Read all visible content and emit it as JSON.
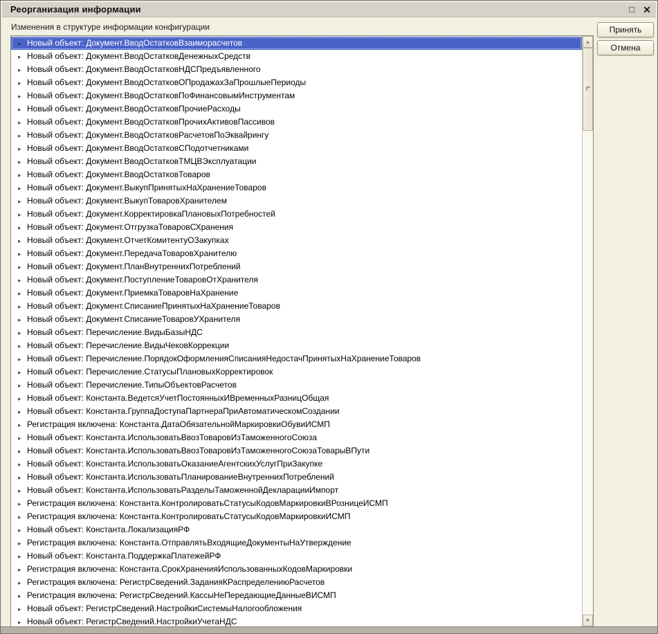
{
  "window": {
    "title": "Реорганизация информации"
  },
  "icons": {
    "maximize_glyph": "□",
    "close_glyph": "✕",
    "row_arrow_glyph": "▸",
    "scroll_up_glyph": "▲",
    "scroll_down_glyph": "▼"
  },
  "colors": {
    "dialog_background": "#f2f0e1",
    "titlebar_background": "#d6d2c9",
    "selection_background": "#4a63c8",
    "selection_text": "#ffffff",
    "list_background": "#ffffff"
  },
  "header": {
    "label": "Изменения в структуре информации конфигурации"
  },
  "buttons": {
    "accept": "Принять",
    "cancel": "Отмена"
  },
  "list": {
    "selected_index": 0,
    "items": [
      {
        "label": "Новый объект: Документ.ВводОстатковВзаиморасчетов"
      },
      {
        "label": "Новый объект: Документ.ВводОстатковДенежныхСредств"
      },
      {
        "label": "Новый объект: Документ.ВводОстатковНДСПредъявленного"
      },
      {
        "label": "Новый объект: Документ.ВводОстатковОПродажахЗаПрошлыеПериоды"
      },
      {
        "label": "Новый объект: Документ.ВводОстатковПоФинансовымИнструментам"
      },
      {
        "label": "Новый объект: Документ.ВводОстатковПрочиеРасходы"
      },
      {
        "label": "Новый объект: Документ.ВводОстатковПрочихАктивовПассивов"
      },
      {
        "label": "Новый объект: Документ.ВводОстатковРасчетовПоЭквайрингу"
      },
      {
        "label": "Новый объект: Документ.ВводОстатковСПодотчетниками"
      },
      {
        "label": "Новый объект: Документ.ВводОстатковТМЦВЭксплуатации"
      },
      {
        "label": "Новый объект: Документ.ВводОстатковТоваров"
      },
      {
        "label": "Новый объект: Документ.ВыкупПринятыхНаХранениеТоваров"
      },
      {
        "label": "Новый объект: Документ.ВыкупТоваровХранителем"
      },
      {
        "label": "Новый объект: Документ.КорректировкаПлановыхПотребностей"
      },
      {
        "label": "Новый объект: Документ.ОтгрузкаТоваровСХранения"
      },
      {
        "label": "Новый объект: Документ.ОтчетКомитентуОЗакупках"
      },
      {
        "label": "Новый объект: Документ.ПередачаТоваровХранителю"
      },
      {
        "label": "Новый объект: Документ.ПланВнутреннихПотреблений"
      },
      {
        "label": "Новый объект: Документ.ПоступлениеТоваровОтХранителя"
      },
      {
        "label": "Новый объект: Документ.ПриемкаТоваровНаХранение"
      },
      {
        "label": "Новый объект: Документ.СписаниеПринятыхНаХранениеТоваров"
      },
      {
        "label": "Новый объект: Документ.СписаниеТоваровУХранителя"
      },
      {
        "label": "Новый объект: Перечисление.ВидыБазыНДС"
      },
      {
        "label": "Новый объект: Перечисление.ВидыЧековКоррекции"
      },
      {
        "label": "Новый объект: Перечисление.ПорядокОформленияСписанияНедостачПринятыхНаХранениеТоваров"
      },
      {
        "label": "Новый объект: Перечисление.СтатусыПлановыхКорректировок"
      },
      {
        "label": "Новый объект: Перечисление.ТипыОбъектовРасчетов"
      },
      {
        "label": "Новый объект: Константа.ВедетсяУчетПостоянныхИВременныхРазницОбщая"
      },
      {
        "label": "Новый объект: Константа.ГруппаДоступаПартнераПриАвтоматическомСоздании"
      },
      {
        "label": "Регистрация включена: Константа.ДатаОбязательнойМаркировкиОбувиИСМП"
      },
      {
        "label": "Новый объект: Константа.ИспользоватьВвозТоваровИзТаможенногоСоюза"
      },
      {
        "label": "Новый объект: Константа.ИспользоватьВвозТоваровИзТаможенногоСоюзаТоварыВПути"
      },
      {
        "label": "Новый объект: Константа.ИспользоватьОказаниеАгентскихУслугПриЗакупке"
      },
      {
        "label": "Новый объект: Константа.ИспользоватьПланированиеВнутреннихПотреблений"
      },
      {
        "label": "Новый объект: Константа.ИспользоватьРазделыТаможеннойДекларацииИмпорт"
      },
      {
        "label": "Регистрация включена: Константа.КонтролироватьСтатусыКодовМаркировкиВРозницеИСМП"
      },
      {
        "label": "Регистрация включена: Константа.КонтролироватьСтатусыКодовМаркировкиИСМП"
      },
      {
        "label": "Новый объект: Константа.ЛокализацияРФ"
      },
      {
        "label": "Регистрация включена: Константа.ОтправлятьВходящиеДокументыНаУтверждение"
      },
      {
        "label": "Новый объект: Константа.ПоддержкаПлатежейРФ"
      },
      {
        "label": "Регистрация включена: Константа.СрокХраненияИспользованныхКодовМаркировки"
      },
      {
        "label": "Регистрация включена: РегистрСведений.ЗаданияКРаспределениюРасчетов"
      },
      {
        "label": "Регистрация включена: РегистрСведений.КассыНеПередающиеДанныеВИСМП"
      },
      {
        "label": "Новый объект: РегистрСведений.НастройкиСистемыНалогообложения"
      },
      {
        "label": "Новый объект: РегистрСведений.НастройкиУчетаНДС"
      }
    ]
  }
}
